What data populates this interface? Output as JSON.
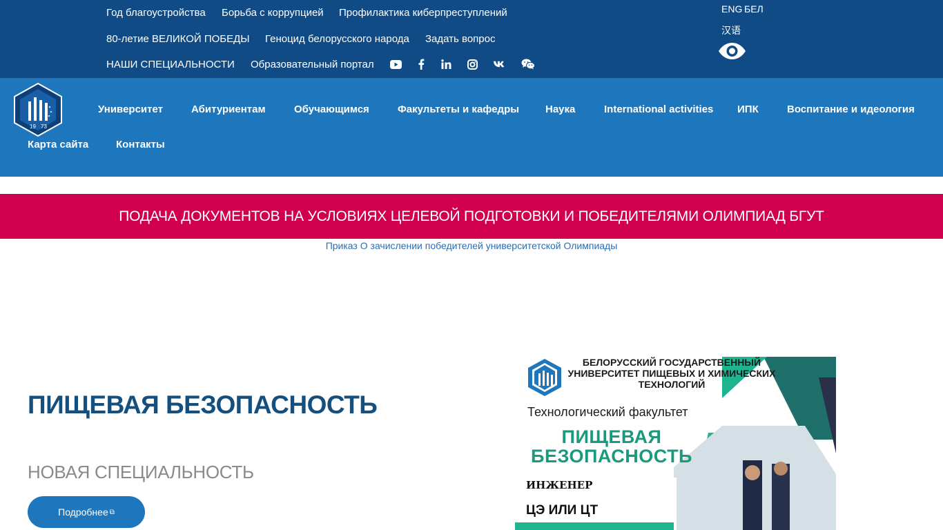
{
  "top_links": [
    "Год благоустройства",
    "Борьба с коррупцией",
    "Профилактика киберпреступлений",
    "80-летие ВЕЛИКОЙ ПОБЕДЫ",
    "Геноцид белорусского народа",
    "Задать вопрос",
    "НАШИ СПЕЦИАЛЬНОСТИ",
    "Образовательный портал"
  ],
  "social_icons": [
    "youtube-icon",
    "facebook-icon",
    "linkedin-icon",
    "instagram-icon",
    "vk-icon",
    "wechat-icon"
  ],
  "languages": {
    "eng": "ENG",
    "bel": "БЕЛ",
    "chinese": "汉语"
  },
  "nav": [
    "Университет",
    "Абитуриентам",
    "Обучающимся",
    "Факультеты и кафедры",
    "Наука",
    "International activities",
    "ИПК",
    "Воспитание и идеология",
    "Карта сайта",
    "Контакты"
  ],
  "banner": {
    "text": "ПОДАЧА ДОКУМЕНТОВ НА УСЛОВИЯХ ЦЕЛЕВОЙ ПОДГОТОВКИ И ПОБЕДИТЕЛЯМИ ОЛИМПИАД БГУТ",
    "link": "Приказ О зачислении победителей университетской Олимпиады"
  },
  "hero": {
    "title": "ПИЩЕВАЯ БЕЗОПАСНОСТЬ",
    "subtitle": "НОВАЯ СПЕЦИАЛЬНОСТЬ",
    "button": "Подробнее"
  },
  "poster": {
    "university": "БЕЛОРУССКИЙ ГОСУДАРСТВЕННЫЙ УНИВЕРСИТЕТ ПИЩЕВЫХ И ХИМИЧЕСКИХ ТЕХНОЛОГИЙ",
    "faculty": "Технологический факультет",
    "title_line1": "ПИЩЕВАЯ",
    "title_line2": "БЕЗОПАСНОСТЬ",
    "qualification": "ИНЖЕНЕР",
    "exam": "ЦЭ ИЛИ ЦТ"
  },
  "colors": {
    "topbar": "#104b86",
    "navbar": "#1e76bd",
    "banner": "#d0004f",
    "title": "#14507f",
    "poster_green": "#1db58f"
  }
}
